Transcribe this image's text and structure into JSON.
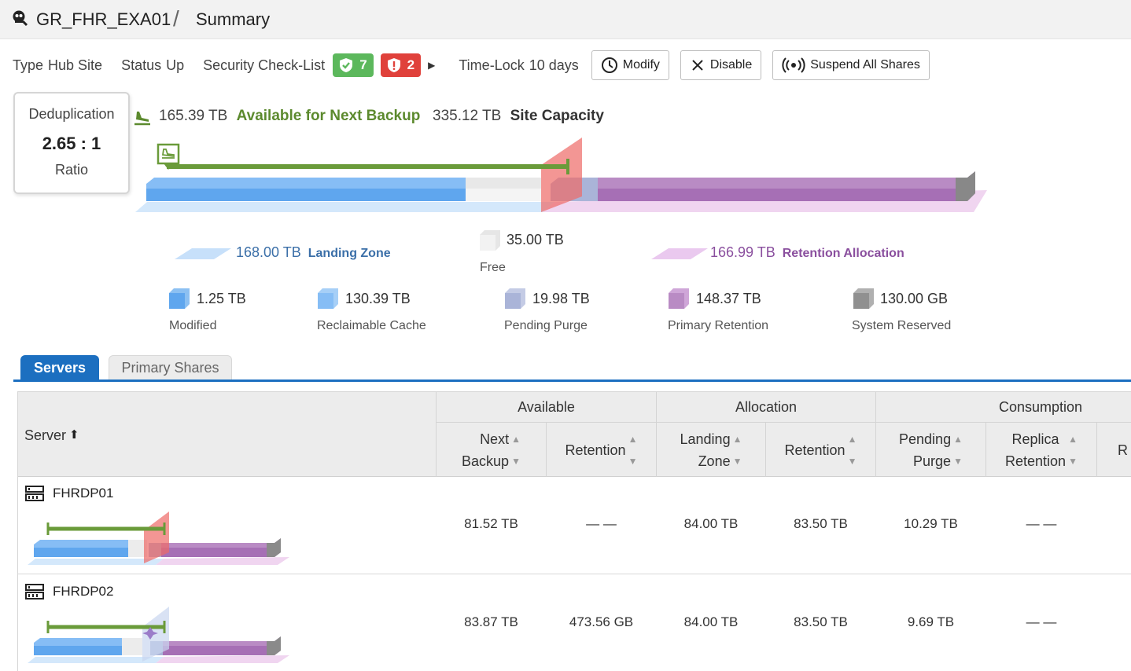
{
  "header": {
    "site_name": "GR_FHR_EXA01",
    "separator": "/",
    "page": "Summary",
    "icon": "site-icon"
  },
  "info": {
    "type_label": "Type",
    "type_value": "Hub Site",
    "status_label": "Status",
    "status_value": "Up",
    "security_label": "Security Check-List",
    "security_ok_count": "7",
    "security_bad_count": "2",
    "timelock_label": "Time-Lock",
    "timelock_value": "10 days",
    "modify_label": "Modify",
    "disable_label": "Disable",
    "suspend_label": "Suspend All Shares"
  },
  "dedup": {
    "title": "Deduplication",
    "value": "2.65 : 1",
    "sub": "Ratio"
  },
  "capacity": {
    "available_num": "165.39 TB",
    "available_label": "Available for Next Backup",
    "site_num": "335.12 TB",
    "site_label": "Site Capacity"
  },
  "legend": {
    "landing_num": "168.00 TB",
    "landing_label": "Landing Zone",
    "free_num": "35.00 TB",
    "free_label": "Free",
    "retention_num": "166.99 TB",
    "retention_label": "Retention Allocation",
    "modified_num": "1.25 TB",
    "modified_label": "Modified",
    "reclaimable_num": "130.39 TB",
    "reclaimable_label": "Reclaimable Cache",
    "pending_num": "19.98 TB",
    "pending_label": "Pending Purge",
    "primary_num": "148.37 TB",
    "primary_label": "Primary Retention",
    "system_num": "130.00 GB",
    "system_label": "System Reserved"
  },
  "colors": {
    "accent": "#1c6fc0",
    "green": "#5c8a2e",
    "landing": "#86bdf5",
    "retention": "#b98bc4",
    "red": "#e0413b"
  },
  "tabs": {
    "servers": "Servers",
    "primary_shares": "Primary Shares"
  },
  "table": {
    "server_header": "Server",
    "group_available": "Available",
    "group_allocation": "Allocation",
    "group_consumption": "Consumption",
    "h_next_backup_1": "Next",
    "h_next_backup_2": "Backup",
    "h_avail_retention": "Retention",
    "h_landing_1": "Landing",
    "h_landing_2": "Zone",
    "h_alloc_retention": "Retention",
    "h_pending_1": "Pending",
    "h_pending_2": "Purge",
    "h_replica_1": "Replica",
    "h_replica_2": "Retention",
    "h_cut": "R",
    "rows": [
      {
        "name": "FHRDP01",
        "next_backup": "81.52 TB",
        "avail_retention": "— —",
        "landing_zone": "84.00 TB",
        "alloc_retention": "83.50 TB",
        "pending_purge": "10.29 TB",
        "replica_retention": "— —"
      },
      {
        "name": "FHRDP02",
        "next_backup": "83.87 TB",
        "avail_retention": "473.56 GB",
        "landing_zone": "84.00 TB",
        "alloc_retention": "83.50 TB",
        "pending_purge": "9.69 TB",
        "replica_retention": "— —"
      }
    ]
  }
}
